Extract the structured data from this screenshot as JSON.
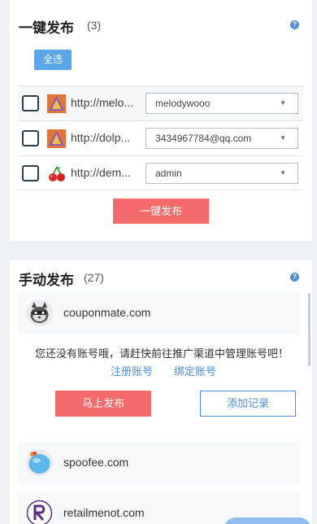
{
  "one_click": {
    "title": "一键发布",
    "count": "(3)",
    "help_glyph": "?",
    "select_all_label": "全选",
    "accounts": [
      {
        "url": "http://melo...",
        "selected": "melodywooo",
        "logo": "triangle-logo-icon"
      },
      {
        "url": "http://dolp...",
        "selected": "3434967784@qq.com",
        "logo": "triangle-logo-icon"
      },
      {
        "url": "http://dem...",
        "selected": "admin",
        "logo": "cherry-icon"
      }
    ],
    "caret_glyph": "▼",
    "publish_label": "一键发布"
  },
  "manual": {
    "title": "手动发布",
    "count": "(27)",
    "help_glyph": "?",
    "sites": [
      {
        "name": "couponmate.com",
        "avatar": "raccoon-avatar-icon"
      },
      {
        "name": "spoofee.com",
        "avatar": "blob-avatar-icon"
      },
      {
        "name": "retailmenot.com",
        "avatar": "letter-r-avatar-icon"
      }
    ],
    "notice_text": "您还没有账号哦，请赶快前往推广渠道中管理账号吧！",
    "register_link": "注册账号",
    "bind_link": "绑定账号",
    "publish_now_label": "马上发布",
    "add_record_label": "添加记录"
  },
  "colors": {
    "primary_red": "#f56a6a",
    "primary_blue": "#4a8fd9",
    "select_all_blue": "#5aa6e8",
    "page_bg": "#eef2f5"
  }
}
